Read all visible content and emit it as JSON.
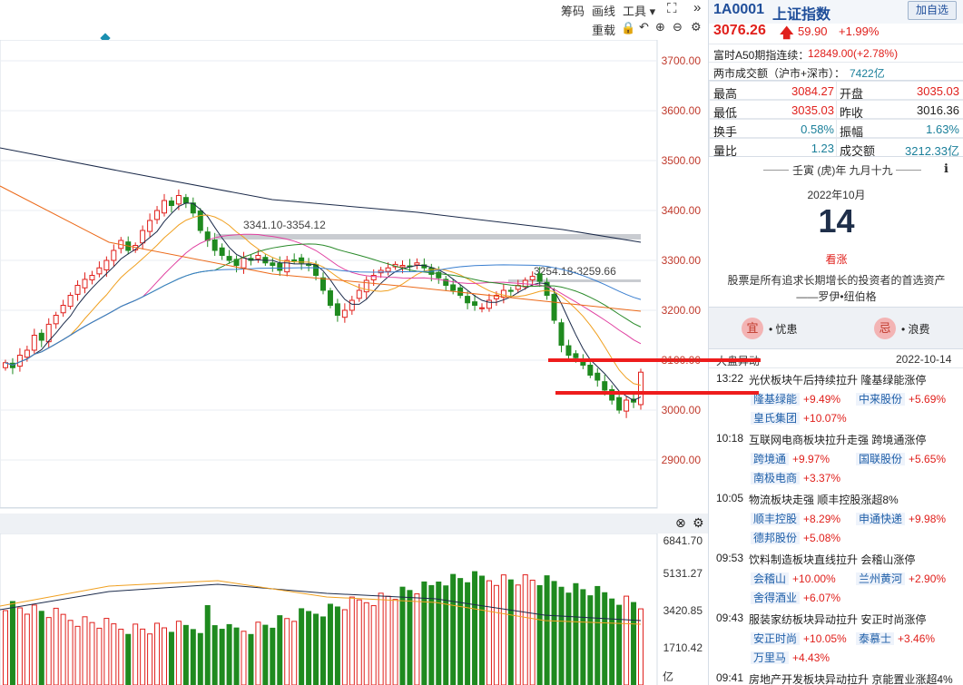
{
  "toolbar": {
    "chips": "筹码",
    "draw": "画线",
    "tools": "工具",
    "reweight": "重载"
  },
  "price_axis": [
    "3700.00",
    "3600.00",
    "3500.00",
    "3400.00",
    "3300.00",
    "3200.00",
    "3100.00",
    "3000.00",
    "2900.00"
  ],
  "vol_axis": [
    "6841.70",
    "5131.27",
    "3420.85",
    "1710.42",
    "亿"
  ],
  "annotations": {
    "upper_band": "3341.10-3354.12",
    "lower_band": "3254.18-3259.66"
  },
  "header": {
    "code": "1A0001",
    "name": "上证指数",
    "watch_button": "加自选",
    "price": "3076.26",
    "change": "59.90",
    "change_pct": "+1.99%",
    "futures_label": "富时A50期指连续：",
    "futures_value": "12849.00(+2.78%)",
    "turnover_label": "两市成交额（沪市+深市）：",
    "turnover_value": "7422亿"
  },
  "stats": {
    "high_label": "最高",
    "high": "3084.27",
    "open_label": "开盘",
    "open": "3035.03",
    "low_label": "最低",
    "low": "3035.03",
    "prev_label": "昨收",
    "prev": "3016.36",
    "turnover_rate_label": "换手",
    "turnover_rate": "0.58%",
    "amplitude_label": "振幅",
    "amplitude": "1.63%",
    "volume_ratio_label": "量比",
    "volume_ratio": "1.23",
    "amount_label": "成交额",
    "amount": "3212.33亿"
  },
  "calendar": {
    "lunar": "壬寅 (虎)年 九月十九",
    "month": "2022年10月",
    "day": "14",
    "outlook": "看涨",
    "quote": "股票是所有追求长期增长的投资者的首选资产",
    "author": "——罗伊•纽伯格",
    "yi_badge": "宜",
    "yi_text": "• 忧患",
    "ji_badge": "忌",
    "ji_text": "• 浪费"
  },
  "news": {
    "section_title": "大盘异动",
    "date": "2022-10-14",
    "items": [
      {
        "time": "13:22",
        "title": "光伏板块午后持续拉升 隆基绿能涨停",
        "stocks": [
          {
            "name": "隆基绿能",
            "chg": "+9.49%"
          },
          {
            "name": "中来股份",
            "chg": "+5.69%"
          },
          {
            "name": "皇氏集团",
            "chg": "+10.07%"
          }
        ]
      },
      {
        "time": "10:18",
        "title": "互联网电商板块拉升走强 跨境通涨停",
        "stocks": [
          {
            "name": "跨境通",
            "chg": "+9.97%"
          },
          {
            "name": "国联股份",
            "chg": "+5.65%"
          },
          {
            "name": "南极电商",
            "chg": "+3.37%"
          }
        ]
      },
      {
        "time": "10:05",
        "title": "物流板块走强 顺丰控股涨超8%",
        "stocks": [
          {
            "name": "顺丰控股",
            "chg": "+8.29%"
          },
          {
            "name": "申通快递",
            "chg": "+9.98%"
          },
          {
            "name": "德邦股份",
            "chg": "+5.08%"
          }
        ]
      },
      {
        "time": "09:53",
        "title": "饮料制造板块直线拉升 会稽山涨停",
        "stocks": [
          {
            "name": "会稽山",
            "chg": "+10.00%"
          },
          {
            "name": "兰州黄河",
            "chg": "+2.90%"
          },
          {
            "name": "舍得酒业",
            "chg": "+6.07%"
          }
        ]
      },
      {
        "time": "09:43",
        "title": "服装家纺板块异动拉升 安正时尚涨停",
        "stocks": [
          {
            "name": "安正时尚",
            "chg": "+10.05%"
          },
          {
            "name": "泰慕士",
            "chg": "+3.46%"
          },
          {
            "name": "万里马",
            "chg": "+4.43%"
          }
        ]
      },
      {
        "time": "09:41",
        "title": "房地产开发板块异动拉升 京能置业涨超4%",
        "stocks": []
      }
    ]
  },
  "colors": {
    "up": "#e0201c",
    "down": "#1f8a1f",
    "accent": "#1a7f9a"
  }
}
